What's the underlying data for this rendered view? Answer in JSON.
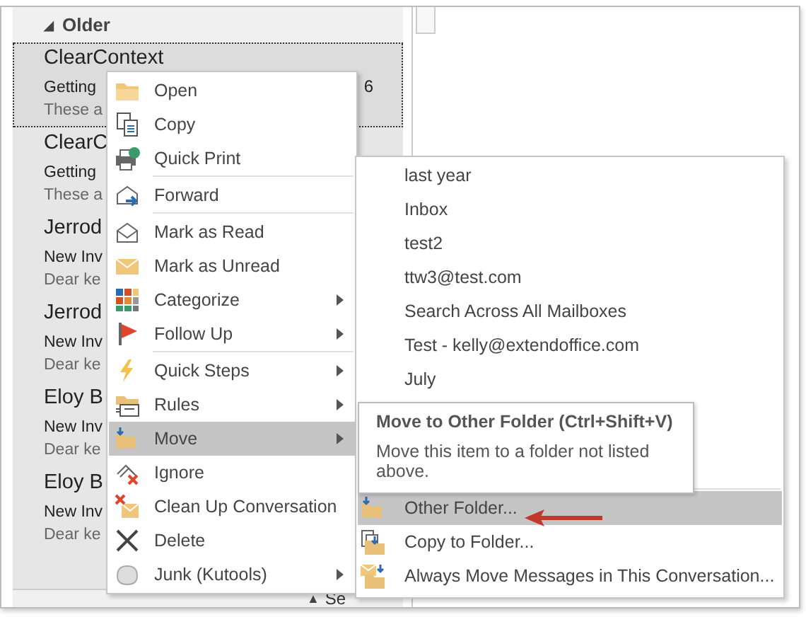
{
  "group_header": {
    "toggle": "◢",
    "label": "Older"
  },
  "messages": [
    {
      "sender": "ClearContext",
      "subject": "Getting",
      "date": "6",
      "preview": "These a",
      "selected": true
    },
    {
      "sender": "ClearC",
      "subject": "Getting",
      "preview": "These a",
      "selected": false
    },
    {
      "sender": "Jerrod",
      "subject": "New Inv",
      "preview": "Dear ke",
      "selected": false
    },
    {
      "sender": "Jerrod",
      "subject": "New Inv",
      "preview": "Dear ke",
      "selected": false
    },
    {
      "sender": "Eloy B",
      "subject": "New Inv",
      "preview": "Dear ke",
      "selected": false
    },
    {
      "sender": "Eloy B",
      "subject": "New Inv",
      "preview": "Dear ke",
      "selected": false
    }
  ],
  "status_bar": {
    "toggle": "▲",
    "label": "Se"
  },
  "context_menu": [
    {
      "label": "Open",
      "selected": false,
      "submenu": false,
      "separator_before": false
    },
    {
      "label": "Copy",
      "selected": false,
      "submenu": false,
      "separator_before": false
    },
    {
      "label": "Quick Print",
      "selected": false,
      "submenu": false,
      "separator_before": false
    },
    {
      "label": "Forward",
      "selected": false,
      "submenu": false,
      "separator_before": true
    },
    {
      "label": "Mark as Read",
      "selected": false,
      "submenu": false,
      "separator_before": true
    },
    {
      "label": "Mark as Unread",
      "selected": false,
      "submenu": false,
      "separator_before": false
    },
    {
      "label": "Categorize",
      "selected": false,
      "submenu": true,
      "separator_before": false
    },
    {
      "label": "Follow Up",
      "selected": false,
      "submenu": true,
      "separator_before": false
    },
    {
      "label": "Quick Steps",
      "selected": false,
      "submenu": true,
      "separator_before": true
    },
    {
      "label": "Rules",
      "selected": false,
      "submenu": true,
      "separator_before": false
    },
    {
      "label": "Move",
      "selected": true,
      "submenu": true,
      "separator_before": false
    },
    {
      "label": "Ignore",
      "selected": false,
      "submenu": false,
      "separator_before": false
    },
    {
      "label": "Clean Up Conversation",
      "selected": false,
      "submenu": false,
      "separator_before": false
    },
    {
      "label": "Delete",
      "selected": false,
      "submenu": false,
      "separator_before": false
    },
    {
      "label": "Junk (Kutools)",
      "selected": false,
      "submenu": true,
      "separator_before": false
    }
  ],
  "move_submenu": {
    "folders": [
      {
        "label": "last year"
      },
      {
        "label": "Inbox"
      },
      {
        "label": "test2"
      },
      {
        "label": "ttw3@test.com"
      },
      {
        "label": "Search Across All Mailboxes"
      },
      {
        "label": "Test - kelly@extendoffice.com"
      },
      {
        "label": "July"
      }
    ],
    "actions": [
      {
        "label": "Other Folder...",
        "selected": true
      },
      {
        "label": "Copy to Folder...",
        "selected": false
      },
      {
        "label": "Always Move Messages in This Conversation...",
        "selected": false
      }
    ]
  },
  "tooltip": {
    "title": "Move to Other Folder (Ctrl+Shift+V)",
    "text": "Move this item to a folder not listed above."
  }
}
